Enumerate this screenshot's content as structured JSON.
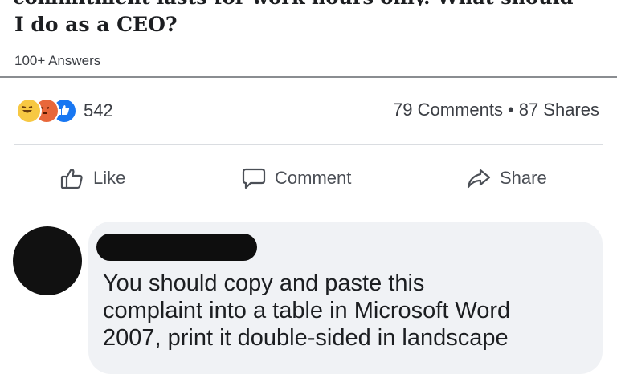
{
  "post": {
    "question_prev_line": "commitment lasts for work hours only. What should",
    "question_line": "I do as a CEO?",
    "answers": "100+ Answers"
  },
  "stats": {
    "reaction_count": "542",
    "reactions": [
      "haha-icon",
      "angry-icon",
      "like-icon"
    ],
    "comments": "79 Comments",
    "separator": "•",
    "shares": "87 Shares"
  },
  "actions": {
    "like": "Like",
    "comment": "Comment",
    "share": "Share"
  },
  "comment": {
    "lines": [
      "You should copy and paste this",
      "complaint into a table in Microsoft Word",
      "2007, print it double-sided in landscape"
    ]
  },
  "colors": {
    "like_blue": "#1877f2",
    "angry_orange": "#e8673a",
    "haha_yellow": "#f7c843",
    "bubble_bg": "#f0f2f5"
  }
}
